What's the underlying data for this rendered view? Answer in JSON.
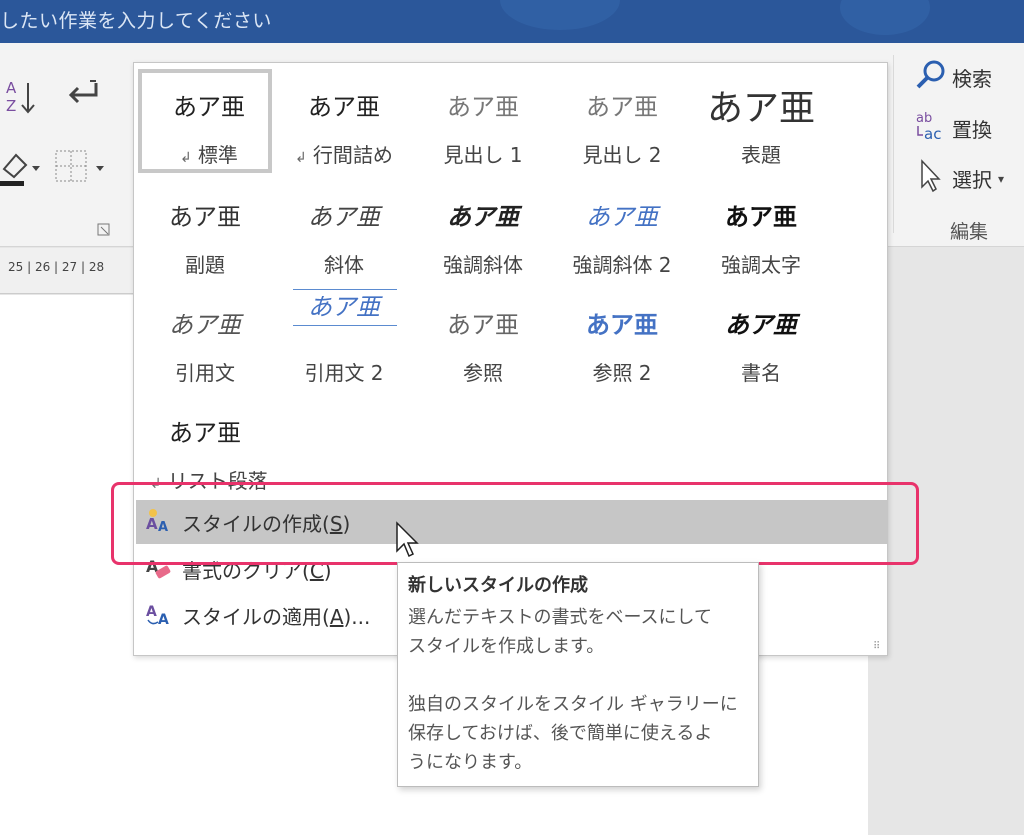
{
  "titlebar": {
    "tell_me": "したい作業を入力してください"
  },
  "ribbon": {
    "editing": {
      "find": "検索",
      "replace": "置換",
      "select": "選択",
      "group_label": "編集"
    },
    "sort_icon_text": "A Z"
  },
  "ruler": {
    "numbers": "25  |  26  |  27  |  28"
  },
  "gallery": {
    "styles": [
      {
        "sample": "あア亜",
        "name": "標準",
        "mark": "↲"
      },
      {
        "sample": "あア亜",
        "name": "行間詰め",
        "mark": "↲"
      },
      {
        "sample": "あア亜",
        "name": "見出し 1"
      },
      {
        "sample": "あア亜",
        "name": "見出し 2"
      },
      {
        "sample": "あア亜",
        "name": "表題"
      },
      {
        "sample": "あア亜",
        "name": "副題"
      },
      {
        "sample": "あア亜",
        "name": "斜体"
      },
      {
        "sample": "あア亜",
        "name": "強調斜体"
      },
      {
        "sample": "あア亜",
        "name": "強調斜体 2"
      },
      {
        "sample": "あア亜",
        "name": "強調太字"
      },
      {
        "sample": "あア亜",
        "name": "引用文"
      },
      {
        "sample": "あア亜",
        "name": "引用文 2"
      },
      {
        "sample": "あア亜",
        "name": "参照"
      },
      {
        "sample": "あア亜",
        "name": "参照 2"
      },
      {
        "sample": "あア亜",
        "name": "書名"
      },
      {
        "sample": "あア亜",
        "name": "リスト段落",
        "mark": "↲"
      }
    ],
    "commands": {
      "create": {
        "label": "スタイルの作成(",
        "key": "S",
        "suffix": ")"
      },
      "clear": {
        "label": "書式のクリア(",
        "key": "C",
        "suffix": ")"
      },
      "apply": {
        "label": "スタイルの適用(",
        "key": "A",
        "suffix": ")..."
      }
    }
  },
  "tooltip": {
    "title": "新しいスタイルの作成",
    "lines": [
      "選んだテキストの書式をベースにして",
      "スタイルを作成します。",
      "独自のスタイルをスタイル ギャラリーに",
      "保存しておけば、後で簡単に使えるよ",
      "うになります。"
    ]
  },
  "colors": {
    "titlebar": "#2b579a",
    "highlight": "#e8336b",
    "accent_blue": "#4472c4"
  }
}
